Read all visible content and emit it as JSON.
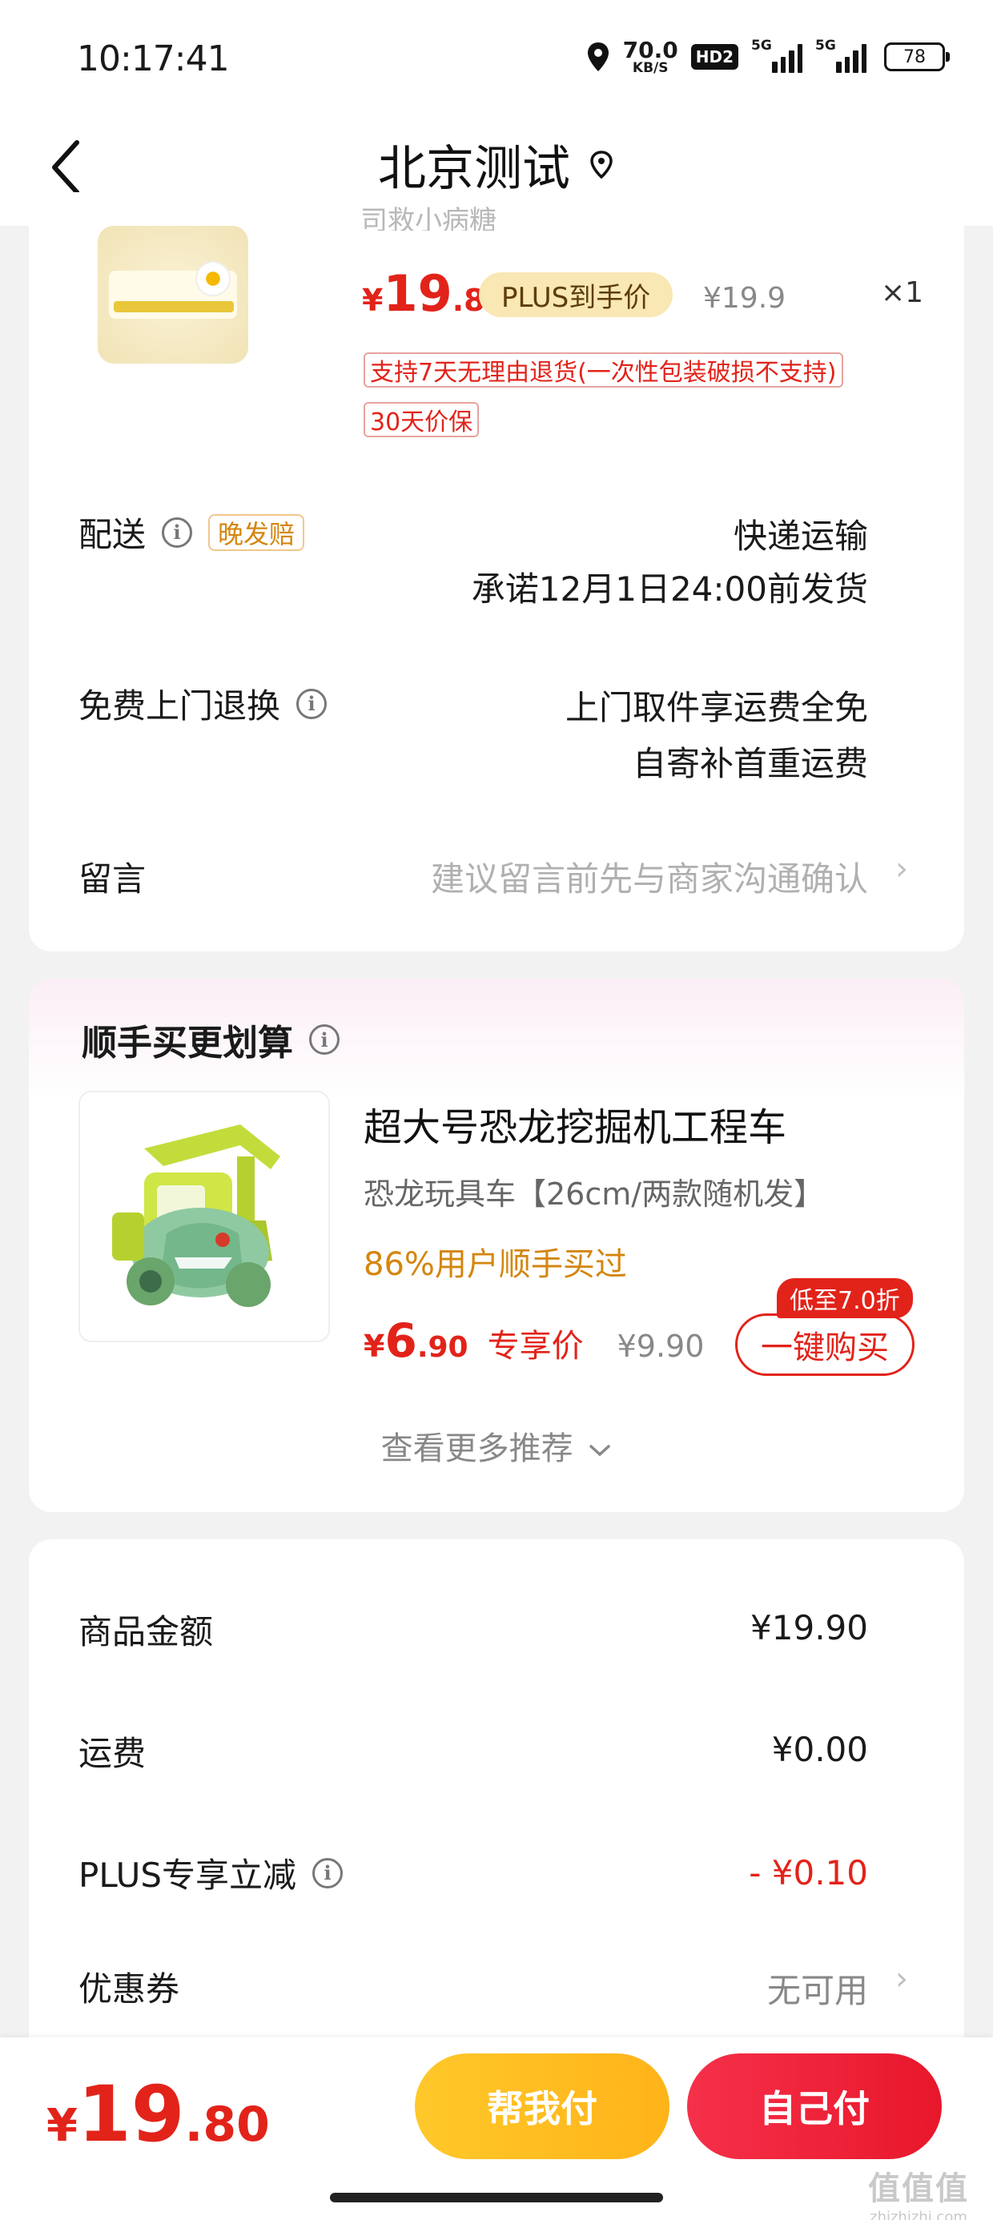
{
  "status_bar": {
    "time": "10:17:41",
    "net_speed_value": "70.0",
    "net_speed_unit": "KB/S",
    "hd_badge": "HD2",
    "signal1_label": "5G",
    "signal2_label": "5G",
    "battery": "78"
  },
  "nav": {
    "title": "北京测试",
    "back_icon": "chevron-left-icon",
    "location_icon": "location-pin-icon"
  },
  "product": {
    "cut_text": "司救小病糖",
    "price_currency": "¥",
    "price_int": "19",
    "price_dec": ".8",
    "plus_badge": "PLUS到手价",
    "orig_price": "¥19.9",
    "qty": "×1",
    "tag_return": "支持7天无理由退货(一次性包装破损不支持)",
    "tag_price_protect": "30天价保"
  },
  "delivery": {
    "label": "配送",
    "late_badge": "晚发赔",
    "method": "快递运输",
    "promise": "承诺12月1日24:00前发货"
  },
  "returns": {
    "label": "免费上门退换",
    "line1": "上门取件享运费全免",
    "line2": "自寄补首重运费"
  },
  "message": {
    "label": "留言",
    "placeholder": "建议留言前先与商家沟通确认"
  },
  "addon": {
    "title": "顺手买更划算",
    "name": "超大号恐龙挖掘机工程车",
    "sub": "恐龙玩具车【26cm/两款随机发】",
    "social": "86%用户顺手买过",
    "price_currency": "¥",
    "price_int": "6",
    "price_dec": ".90",
    "exclusive": "专享价",
    "orig_price": "¥9.90",
    "discount_tag": "低至7.0折",
    "buy_button": "一键购买",
    "more": "查看更多推荐"
  },
  "summary": {
    "goods_label": "商品金额",
    "goods_value": "¥19.90",
    "shipping_label": "运费",
    "shipping_value": "¥0.00",
    "plus_label": "PLUS专享立减",
    "plus_value": "- ¥0.10",
    "coupon_label": "优惠券",
    "coupon_value": "无可用"
  },
  "bottom": {
    "total_currency": "¥",
    "total_int": "19",
    "total_dec": ".80",
    "help_pay": "帮我付",
    "self_pay": "自己付"
  },
  "watermark": {
    "top": "值值值",
    "bottom": "zhizhizhi.com"
  },
  "colors": {
    "accent_red": "#e2231a",
    "gold": "#ffb319",
    "orange_text": "#d4860e"
  }
}
